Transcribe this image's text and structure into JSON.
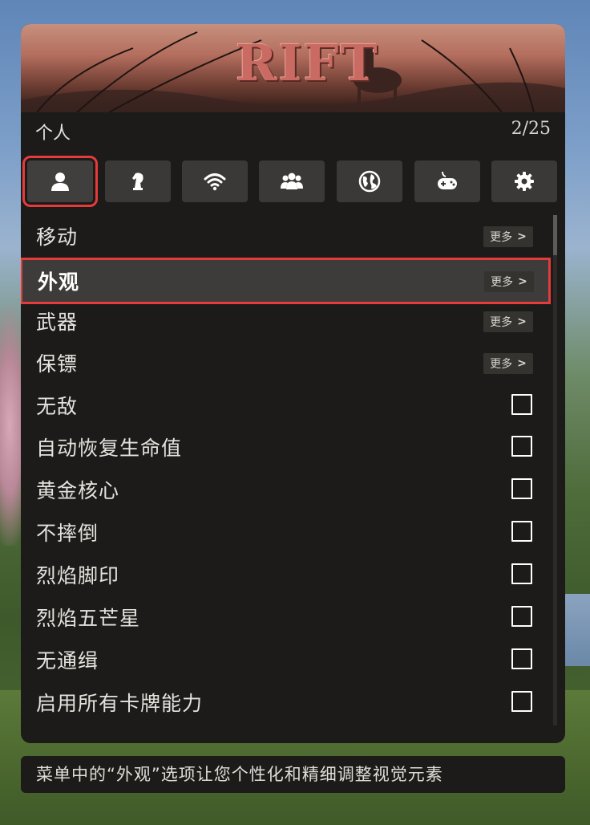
{
  "banner": {
    "logo_text": "RIFT"
  },
  "header": {
    "title": "个人",
    "count": "2/25"
  },
  "tabs": [
    {
      "icon": "person-icon",
      "active": true
    },
    {
      "icon": "chess-knight-icon",
      "active": false
    },
    {
      "icon": "wifi-icon",
      "active": false
    },
    {
      "icon": "group-icon",
      "active": false
    },
    {
      "icon": "globe-icon",
      "active": false
    },
    {
      "icon": "gamepad-icon",
      "active": false
    },
    {
      "icon": "gear-icon",
      "active": false
    }
  ],
  "menu": {
    "items": [
      {
        "label": "移动",
        "type": "submenu",
        "more": "更多",
        "selected": false
      },
      {
        "label": "外观",
        "type": "submenu",
        "more": "更多",
        "selected": true
      },
      {
        "label": "武器",
        "type": "submenu",
        "more": "更多",
        "selected": false
      },
      {
        "label": "保镖",
        "type": "submenu",
        "more": "更多",
        "selected": false
      },
      {
        "label": "无敌",
        "type": "toggle",
        "checked": false
      },
      {
        "label": "自动恢复生命值",
        "type": "toggle",
        "checked": false
      },
      {
        "label": "黄金核心",
        "type": "toggle",
        "checked": false
      },
      {
        "label": "不摔倒",
        "type": "toggle",
        "checked": false
      },
      {
        "label": "烈焰脚印",
        "type": "toggle",
        "checked": false
      },
      {
        "label": "烈焰五芒星",
        "type": "toggle",
        "checked": false
      },
      {
        "label": "无通缉",
        "type": "toggle",
        "checked": false
      },
      {
        "label": "启用所有卡牌能力",
        "type": "toggle",
        "checked": false
      }
    ]
  },
  "footer": {
    "description": "菜单中的“外观”选项让您个性化和精细调整视觉元素"
  },
  "colors": {
    "accent": "#e53b3b",
    "panel_bg": "#1c1b19",
    "tab_bg": "#3a3937",
    "selected_row_bg": "#3d3c3a"
  }
}
